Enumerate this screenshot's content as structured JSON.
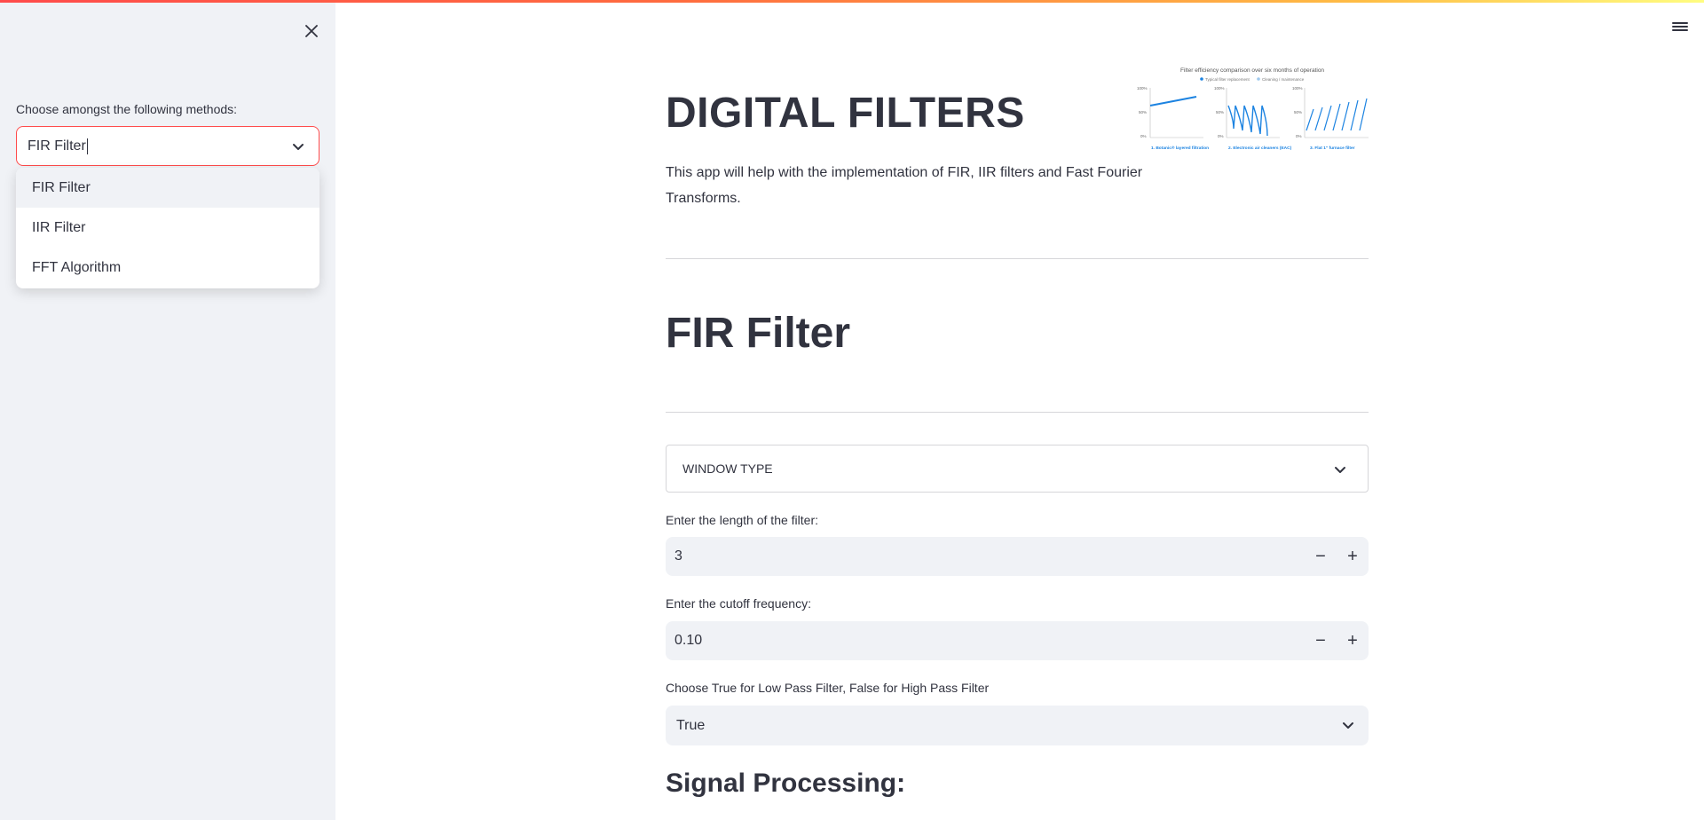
{
  "sidebar": {
    "select_label": "Choose amongst the following methods:",
    "select_value": "FIR Filter",
    "options": [
      "FIR Filter",
      "IIR Filter",
      "FFT Algorithm"
    ]
  },
  "main": {
    "title": "DIGITAL FILTERS",
    "intro": "This app will help with the implementation of FIR, IIR filters and Fast Fourier Transforms.",
    "section_title": "FIR Filter",
    "window_select": "WINDOW TYPE",
    "length_label": "Enter the length of the filter:",
    "length_value": "3",
    "cutoff_label": "Enter the cutoff frequency:",
    "cutoff_value": "0.10",
    "pass_label": "Choose True for Low Pass Filter, False for High Pass Filter",
    "pass_value": "True",
    "signal_title": "Signal Processing:",
    "stepper_minus": "−",
    "stepper_plus": "+"
  },
  "thumbnail": {
    "title": "Filter efficiency comparison over six months of operation",
    "legend": [
      "Typical filter replacement",
      "Cleaning / maintenance"
    ],
    "panels": [
      "1. Botanic® layered filtration",
      "2. Electronic air cleaners (EAC)",
      "3. Flat 1\" furnace filter"
    ],
    "y_ticks": [
      "100%",
      "50%",
      "0%"
    ]
  },
  "colors": {
    "accent": "#ff4b4b",
    "sidebar_bg": "#f0f2f6",
    "text": "#31333f",
    "chart_blue": "#1c83e1"
  }
}
